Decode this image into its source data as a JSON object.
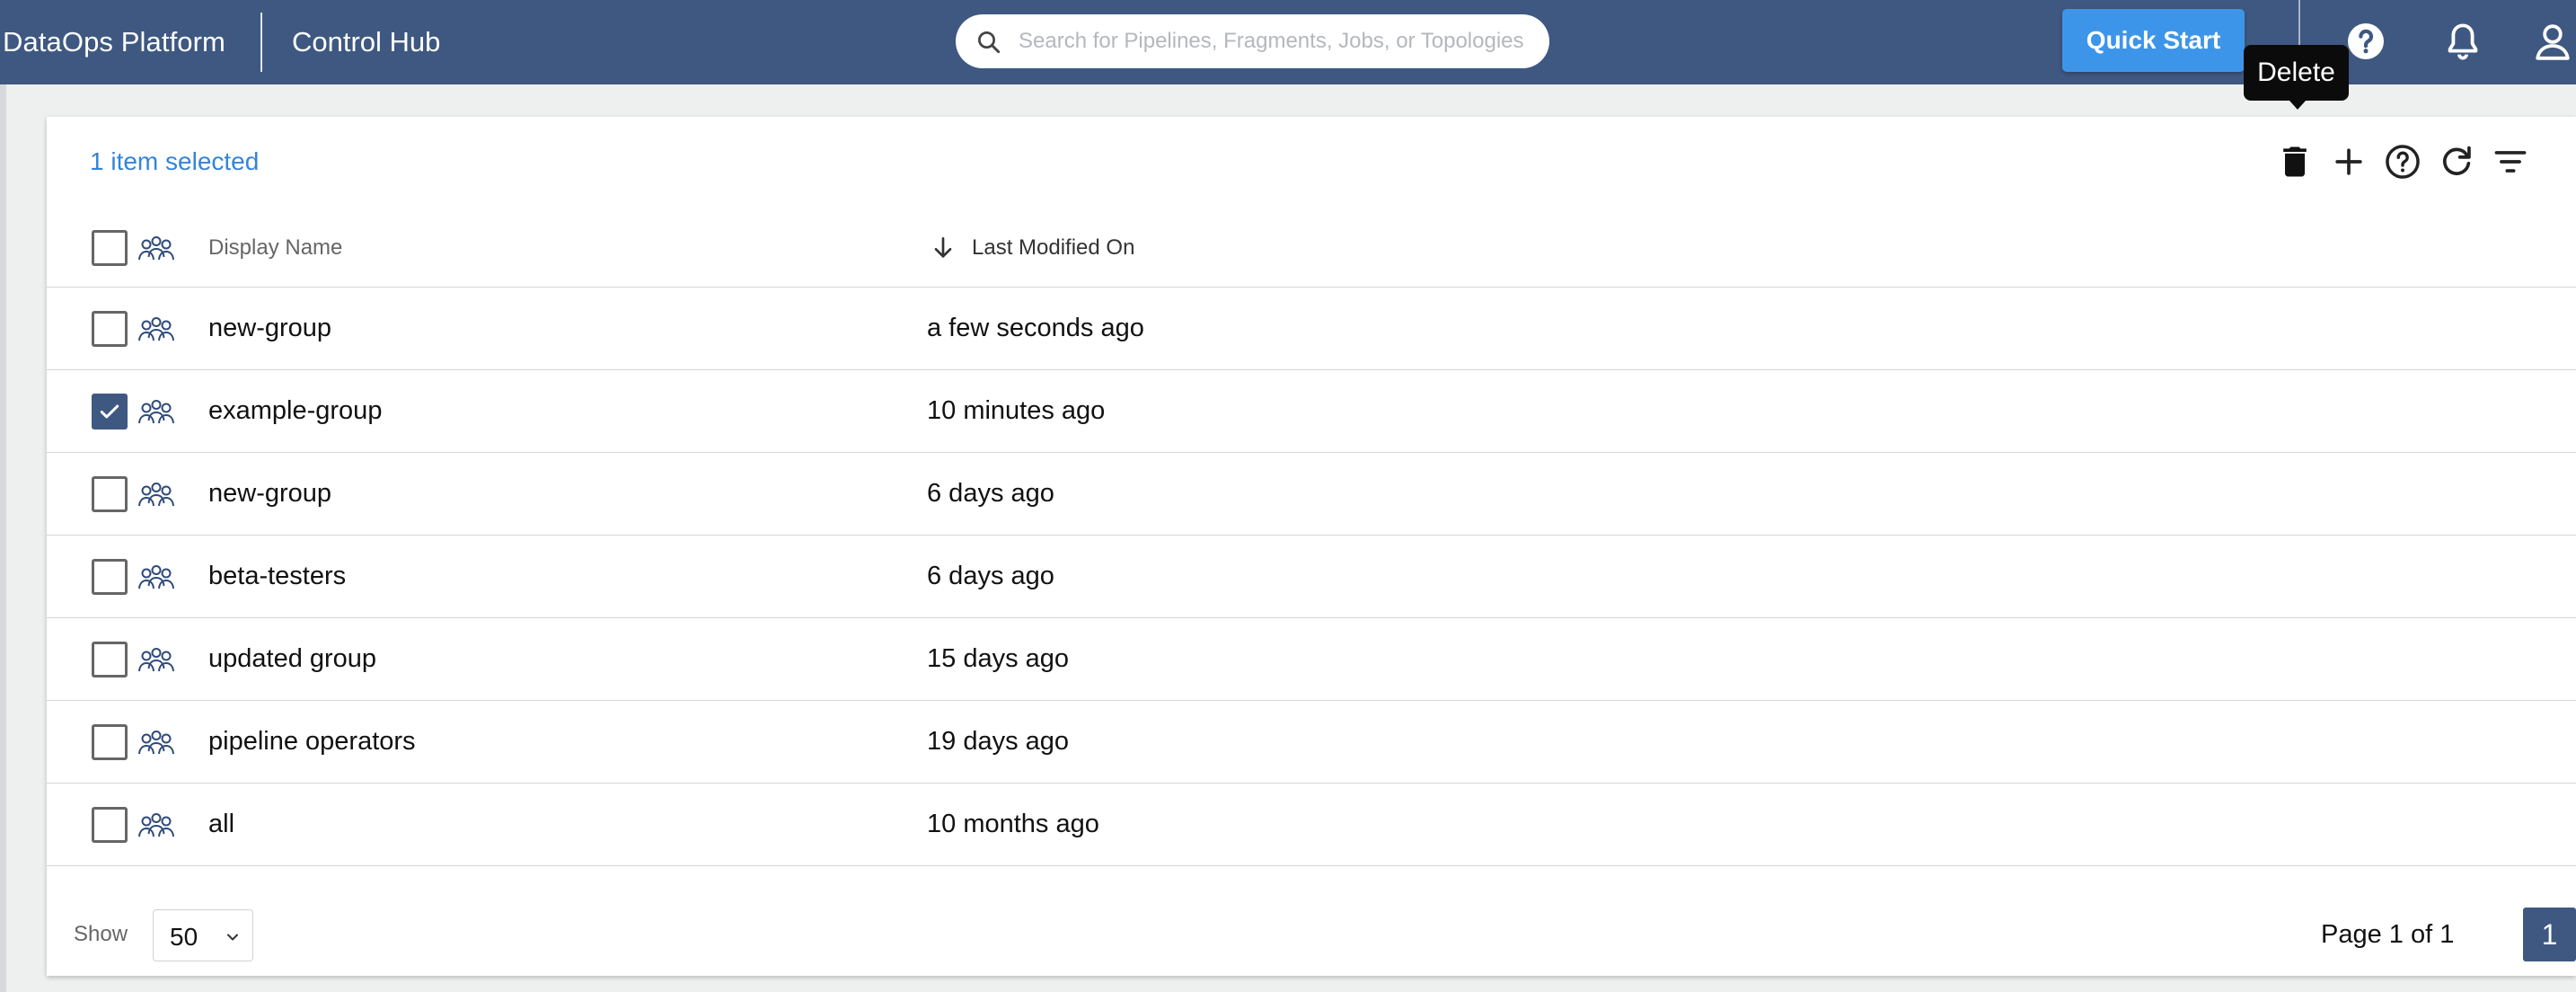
{
  "header": {
    "brand": "DataOps Platform",
    "app_name": "Control Hub",
    "search_placeholder": "Search for Pipelines, Fragments, Jobs, or Topologies",
    "search_value": "",
    "quick_start_label": "Quick Start",
    "icons": [
      "search-icon",
      "help-icon",
      "bell-icon",
      "user-icon"
    ]
  },
  "tooltip": {
    "text": "Delete"
  },
  "toolbar": {
    "selection_text": "1 item selected",
    "icons": [
      "trash-icon",
      "plus-icon",
      "help-circle-icon",
      "refresh-icon",
      "filter-icon"
    ]
  },
  "table": {
    "columns": [
      "Display Name",
      "Last Modified On"
    ],
    "sort": {
      "column": "Last Modified On",
      "direction": "descending"
    },
    "rows": [
      {
        "name": "new-group",
        "modified": "a few seconds ago",
        "selected": false
      },
      {
        "name": "example-group",
        "modified": "10 minutes ago",
        "selected": true
      },
      {
        "name": "new-group",
        "modified": "6 days ago",
        "selected": false
      },
      {
        "name": "beta-testers",
        "modified": "6 days ago",
        "selected": false
      },
      {
        "name": "updated group",
        "modified": "15 days ago",
        "selected": false
      },
      {
        "name": "pipeline operators",
        "modified": "19 days ago",
        "selected": false
      },
      {
        "name": "all",
        "modified": "10 months ago",
        "selected": false
      }
    ]
  },
  "footer": {
    "show_label": "Show",
    "page_size": "50",
    "page_info": "Page 1 of 1",
    "current_page": "1"
  },
  "colors": {
    "header_bg": "#3e5881",
    "primary_button": "#3d95ea",
    "link_text": "#3584d6",
    "checkbox_checked": "#3e5881"
  }
}
